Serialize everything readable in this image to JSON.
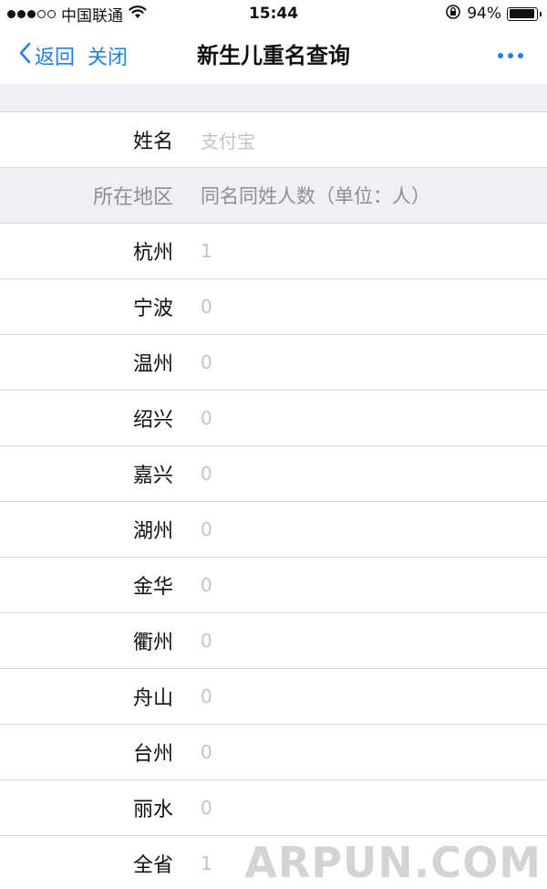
{
  "status_bar": {
    "carrier": "中国联通",
    "time": "15:44",
    "battery_percent": "94%",
    "battery_level": 0.94,
    "signal_filled": 3,
    "signal_total": 5,
    "icons": [
      "signal-dots-icon",
      "wifi-icon",
      "rotation-lock-icon",
      "battery-icon"
    ]
  },
  "nav": {
    "back_label": "返回",
    "close_label": "关闭",
    "title": "新生儿重名查询",
    "accent_color": "#1e80e8"
  },
  "name_row": {
    "label": "姓名",
    "placeholder": "支付宝"
  },
  "table_header": {
    "region_label": "所在地区",
    "count_label": "同名同姓人数（单位：人）"
  },
  "regions": [
    {
      "name": "杭州",
      "count": "1"
    },
    {
      "name": "宁波",
      "count": "0"
    },
    {
      "name": "温州",
      "count": "0"
    },
    {
      "name": "绍兴",
      "count": "0"
    },
    {
      "name": "嘉兴",
      "count": "0"
    },
    {
      "name": "湖州",
      "count": "0"
    },
    {
      "name": "金华",
      "count": "0"
    },
    {
      "name": "衢州",
      "count": "0"
    },
    {
      "name": "舟山",
      "count": "0"
    },
    {
      "name": "台州",
      "count": "0"
    },
    {
      "name": "丽水",
      "count": "0"
    },
    {
      "name": "全省",
      "count": "1"
    }
  ],
  "watermark": "ARPUN.COM"
}
